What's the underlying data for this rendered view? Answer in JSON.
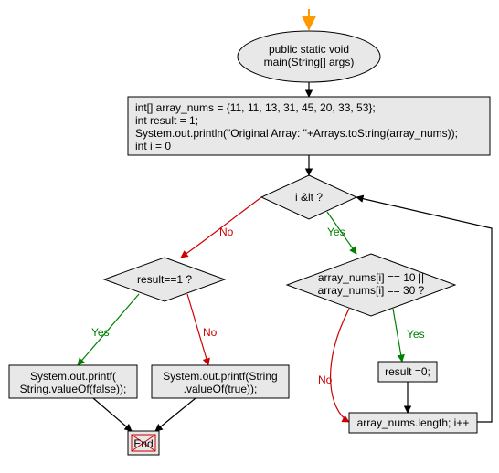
{
  "chart_data": {
    "type": "flowchart",
    "nodes": [
      {
        "id": "start_arrow",
        "shape": "entry-arrow"
      },
      {
        "id": "main",
        "shape": "ellipse",
        "lines": [
          "public static void",
          "main(String[] args)"
        ]
      },
      {
        "id": "init",
        "shape": "rect",
        "lines": [
          "int[] array_nums = {11, 11, 13, 31, 45, 20, 33, 53};",
          "int result = 1;",
          "System.out.println(\"Original Array: \"+Arrays.toString(array_nums));",
          "int i = 0"
        ]
      },
      {
        "id": "i_lt",
        "shape": "diamond",
        "lines": [
          "i &lt ?"
        ]
      },
      {
        "id": "result_eq1",
        "shape": "diamond",
        "lines": [
          "result==1 ?"
        ]
      },
      {
        "id": "check_elem",
        "shape": "diamond",
        "lines": [
          "array_nums[i] == 10 ||",
          "array_nums[i] == 30 ?"
        ]
      },
      {
        "id": "print_false",
        "shape": "rect",
        "lines": [
          "System.out.printf(",
          "String.valueOf(false));"
        ]
      },
      {
        "id": "print_true",
        "shape": "rect",
        "lines": [
          "System.out.printf(String",
          ".valueOf(true));"
        ]
      },
      {
        "id": "result_0",
        "shape": "rect",
        "lines": [
          "result =0;"
        ]
      },
      {
        "id": "increment",
        "shape": "rect",
        "lines": [
          "array_nums.length; i++"
        ]
      },
      {
        "id": "end",
        "shape": "terminator",
        "lines": [
          "End"
        ]
      }
    ],
    "edges": [
      {
        "from": "start_arrow",
        "to": "main"
      },
      {
        "from": "main",
        "to": "init"
      },
      {
        "from": "init",
        "to": "i_lt"
      },
      {
        "from": "i_lt",
        "to": "result_eq1",
        "label": "No",
        "color": "#cc0000"
      },
      {
        "from": "i_lt",
        "to": "check_elem",
        "label": "Yes",
        "color": "#008000"
      },
      {
        "from": "result_eq1",
        "to": "print_false",
        "label": "Yes",
        "color": "#008000"
      },
      {
        "from": "result_eq1",
        "to": "print_true",
        "label": "No",
        "color": "#cc0000"
      },
      {
        "from": "check_elem",
        "to": "result_0",
        "label": "Yes",
        "color": "#008000"
      },
      {
        "from": "check_elem",
        "to": "increment",
        "label": "No",
        "color": "#cc0000"
      },
      {
        "from": "result_0",
        "to": "increment"
      },
      {
        "from": "increment",
        "to": "i_lt"
      },
      {
        "from": "print_false",
        "to": "end"
      },
      {
        "from": "print_true",
        "to": "end"
      }
    ],
    "colors": {
      "node_fill": "#e8e8e8",
      "node_stroke": "#000000",
      "edge_default": "#000000",
      "edge_yes": "#008000",
      "edge_no": "#cc0000",
      "entry_arrow": "#ff9900"
    }
  }
}
